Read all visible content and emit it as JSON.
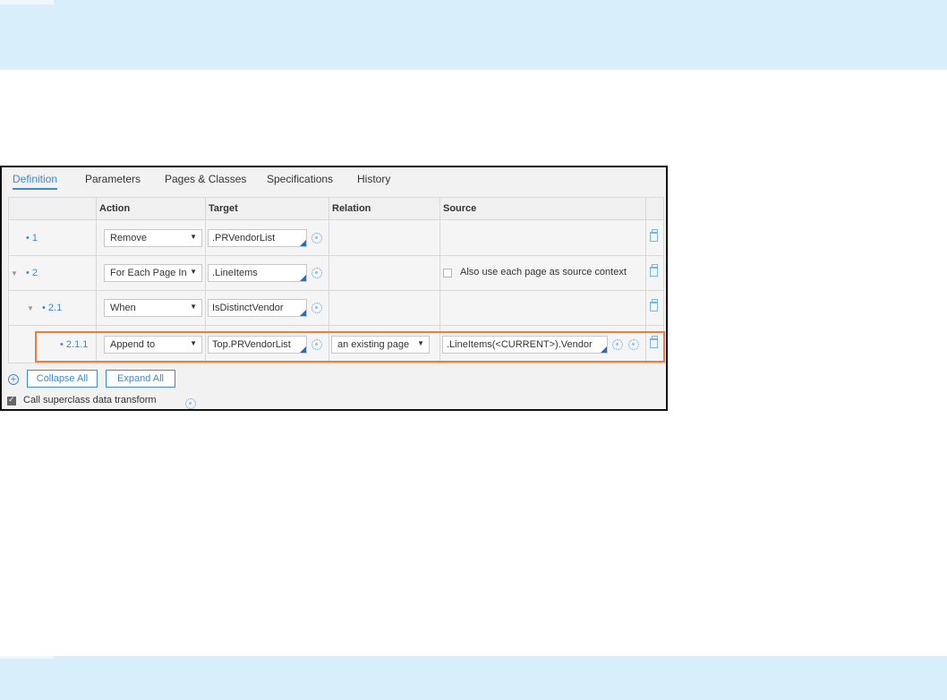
{
  "tabs": [
    {
      "label": "Definition",
      "active": true
    },
    {
      "label": "Parameters",
      "active": false
    },
    {
      "label": "Pages & Classes",
      "active": false
    },
    {
      "label": "Specifications",
      "active": false
    },
    {
      "label": "History",
      "active": false
    }
  ],
  "columns": {
    "action": "Action",
    "target": "Target",
    "relation": "Relation",
    "source": "Source"
  },
  "rows": [
    {
      "label": "1",
      "action": "Remove",
      "target": ".PRVendorList",
      "relation": "",
      "source": ""
    },
    {
      "label": "2",
      "action": "For Each Page In",
      "target": ".LineItems",
      "relation": "",
      "source_checkbox_label": "Also use each page as source context",
      "source_checked": false
    },
    {
      "label": "2.1",
      "action": "When",
      "target": "IsDistinctVendor",
      "relation": "",
      "source": ""
    },
    {
      "label": "2.1.1",
      "action": "Append to",
      "target": "Top.PRVendorList",
      "relation": "an existing page",
      "source": ".LineItems(<CURRENT>).Vendor"
    }
  ],
  "buttons": {
    "collapse_all": "Collapse All",
    "expand_all": "Expand All"
  },
  "footer": {
    "call_superclass_label": "Call superclass data transform",
    "call_superclass_checked": true
  },
  "colors": {
    "accent": "#3a8bd0",
    "highlight": "#ec7d3a",
    "band": "#d8eefa"
  },
  "icons": [
    "add-icon",
    "gear-icon",
    "delete-icon",
    "expand-triangle-icon",
    "dropdown-arrow-icon"
  ]
}
